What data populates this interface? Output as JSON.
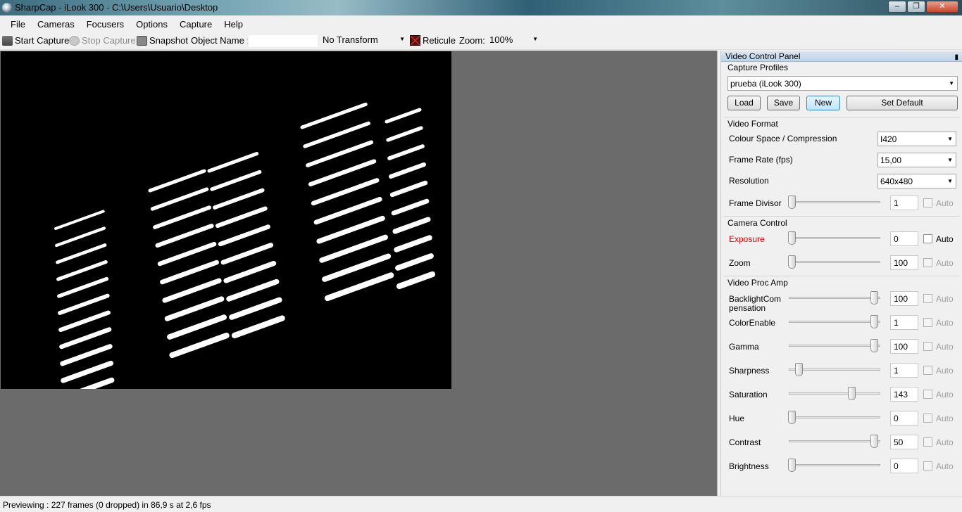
{
  "window": {
    "title": "SharpCap - iLook 300 - C:\\Users\\Usuario\\Desktop"
  },
  "menu": [
    "File",
    "Cameras",
    "Focusers",
    "Options",
    "Capture",
    "Help"
  ],
  "toolbar": {
    "start_capture": "Start Capture",
    "stop_capture": "Stop Capture",
    "snapshot": "Snapshot",
    "object_name_label": "Object Name :",
    "object_name_value": "",
    "transform": "No Transform",
    "reticule": "Reticule",
    "zoom_label": "Zoom:",
    "zoom_value": "100%"
  },
  "panel": {
    "title": "Video Control Panel",
    "capture_profiles": {
      "title": "Capture Profiles",
      "selected": "prueba (iLook 300)",
      "buttons": [
        "Load",
        "Save",
        "New",
        "Set Default"
      ]
    },
    "video_format": {
      "title": "Video Format",
      "colour_space_label": "Colour Space / Compression",
      "colour_space_value": "I420",
      "frame_rate_label": "Frame Rate (fps)",
      "frame_rate_value": "15,00",
      "resolution_label": "Resolution",
      "resolution_value": "640x480",
      "frame_divisor_label": "Frame Divisor",
      "frame_divisor_value": "1",
      "frame_divisor_auto": "Auto"
    },
    "camera_control": {
      "title": "Camera Control",
      "controls": [
        {
          "label": "Exposure",
          "value": "0",
          "auto": "Auto"
        },
        {
          "label": "Zoom",
          "value": "100",
          "auto": "Auto"
        }
      ]
    },
    "video_proc_amp": {
      "title": "Video Proc Amp",
      "controls": [
        {
          "label": "BacklightCom pensation",
          "value": "100",
          "auto": "Auto"
        },
        {
          "label": "ColorEnable",
          "value": "1",
          "auto": "Auto"
        },
        {
          "label": "Gamma",
          "value": "100",
          "auto": "Auto"
        },
        {
          "label": "Sharpness",
          "value": "1",
          "auto": "Auto"
        },
        {
          "label": "Saturation",
          "value": "143",
          "auto": "Auto"
        },
        {
          "label": "Hue",
          "value": "0",
          "auto": "Auto"
        },
        {
          "label": "Contrast",
          "value": "50",
          "auto": "Auto"
        },
        {
          "label": "Brightness",
          "value": "0",
          "auto": "Auto"
        }
      ]
    }
  },
  "slider_levels": {
    "frame_divisor": 0.0,
    "exposure": 0.0,
    "zoom": 0.0,
    "backlight": 0.96,
    "colorenable": 0.96,
    "gamma": 0.96,
    "sharpness": 0.08,
    "saturation": 0.7,
    "hue": 0.0,
    "contrast": 0.96,
    "brightness": 0.0
  },
  "status": {
    "text": "Previewing : 227 frames (0 dropped) in 86,9 s at 2,6 fps"
  }
}
